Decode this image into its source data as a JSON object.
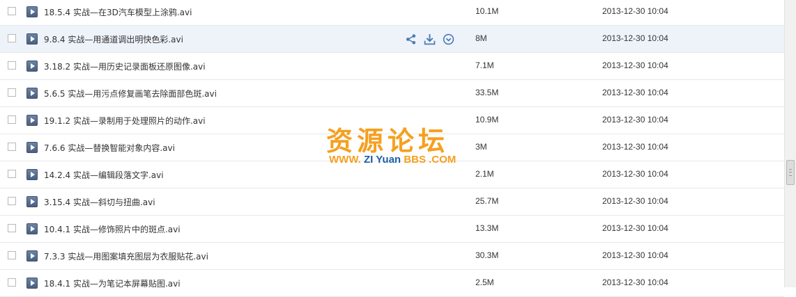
{
  "files": [
    {
      "name": "18.5.4 实战—在3D汽车模型上涂鸦.avi",
      "size": "10.1M",
      "date": "2013-12-30 10:04"
    },
    {
      "name": "9.8.4 实战—用通道调出明快色彩.avi",
      "size": "8M",
      "date": "2013-12-30 10:04",
      "hovered": true
    },
    {
      "name": "3.18.2 实战—用历史记录面板还原图像.avi",
      "size": "7.1M",
      "date": "2013-12-30 10:04"
    },
    {
      "name": "5.6.5 实战—用污点修复画笔去除面部色斑.avi",
      "size": "33.5M",
      "date": "2013-12-30 10:04"
    },
    {
      "name": "19.1.2 实战—录制用于处理照片的动作.avi",
      "size": "10.9M",
      "date": "2013-12-30 10:04"
    },
    {
      "name": "7.6.6 实战—替换智能对象内容.avi",
      "size": "3M",
      "date": "2013-12-30 10:04"
    },
    {
      "name": "14.2.4 实战—编辑段落文字.avi",
      "size": "2.1M",
      "date": "2013-12-30 10:04"
    },
    {
      "name": "3.15.4 实战—斜切与扭曲.avi",
      "size": "25.7M",
      "date": "2013-12-30 10:04"
    },
    {
      "name": "10.4.1 实战—修饰照片中的斑点.avi",
      "size": "13.3M",
      "date": "2013-12-30 10:04"
    },
    {
      "name": "7.3.3 实战—用图案填充图层为衣服贴花.avi",
      "size": "30.3M",
      "date": "2013-12-30 10:04"
    },
    {
      "name": "18.4.1 实战—为笔记本屏幕贴图.avi",
      "size": "2.5M",
      "date": "2013-12-30 10:04"
    }
  ],
  "row_actions": [
    "share-icon",
    "download-icon",
    "more-icon"
  ],
  "watermark": {
    "title": "资源论坛",
    "url_www": "WWW.",
    "url_zi": "ZI",
    "url_yuan": "Yuan",
    "url_bbs": "BBS",
    "url_com": ".COM"
  },
  "colors": {
    "hover_row": "#eef3fa",
    "action_icon": "#4a7ab5",
    "watermark_orange": "#f5a020",
    "watermark_blue": "#1f5fa8"
  }
}
